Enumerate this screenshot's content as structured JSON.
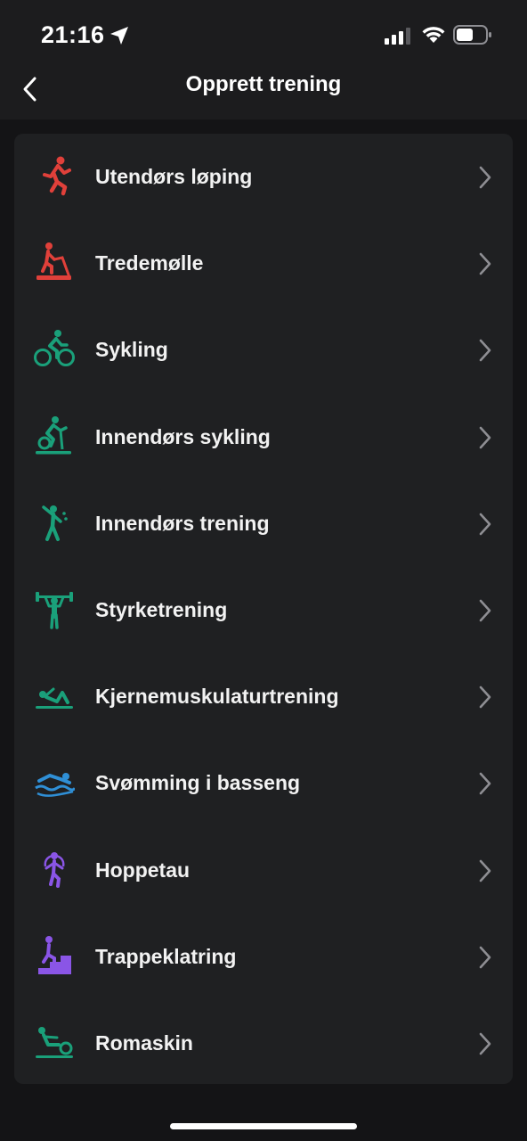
{
  "status_bar": {
    "time": "21:16",
    "icons": [
      "location-arrow-icon",
      "cellular-signal-icon",
      "wifi-icon",
      "battery-icon"
    ]
  },
  "nav": {
    "title": "Opprett trening",
    "back_icon": "chevron-left-icon"
  },
  "colors": {
    "red": "#e0403a",
    "green": "#1aa07a",
    "blue": "#2f8fd6",
    "purple": "#8a55e6",
    "chevron": "#8e8e93"
  },
  "workouts": [
    {
      "label": "Utendørs løping",
      "icon": "outdoor-run-icon",
      "color": "#e0403a"
    },
    {
      "label": "Tredemølle",
      "icon": "treadmill-icon",
      "color": "#e0403a"
    },
    {
      "label": "Sykling",
      "icon": "cycling-icon",
      "color": "#1aa07a"
    },
    {
      "label": "Innendørs sykling",
      "icon": "indoor-cycling-icon",
      "color": "#1aa07a"
    },
    {
      "label": "Innendørs trening",
      "icon": "indoor-training-icon",
      "color": "#1aa07a"
    },
    {
      "label": "Styrketrening",
      "icon": "strength-training-icon",
      "color": "#1aa07a"
    },
    {
      "label": "Kjernemuskulaturtrening",
      "icon": "core-training-icon",
      "color": "#1aa07a"
    },
    {
      "label": "Svømming i basseng",
      "icon": "pool-swimming-icon",
      "color": "#2f8fd6"
    },
    {
      "label": "Hoppetau",
      "icon": "jump-rope-icon",
      "color": "#8a55e6"
    },
    {
      "label": "Trappeklatring",
      "icon": "stair-climbing-icon",
      "color": "#8a55e6"
    },
    {
      "label": "Romaskin",
      "icon": "rowing-machine-icon",
      "color": "#1aa07a"
    }
  ]
}
